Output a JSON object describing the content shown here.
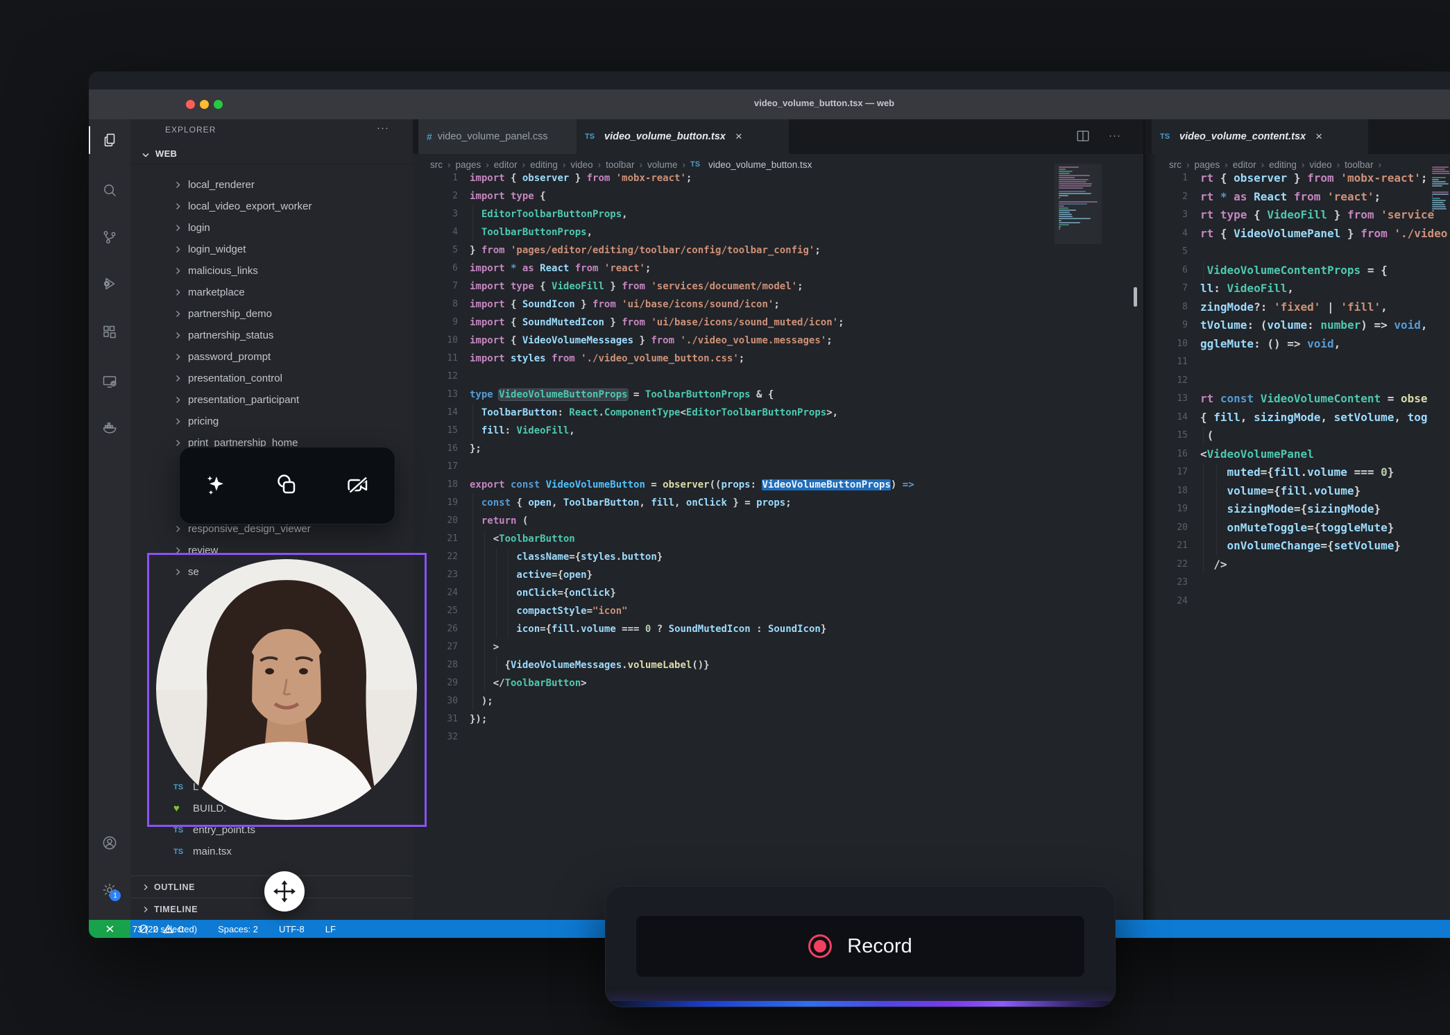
{
  "palette": {
    "kw": "#C586C0",
    "kc": "#569CD6",
    "var": "#9CDCFE",
    "typ": "#4EC9B0",
    "fn": "#DCDCAA",
    "str": "#CE9178",
    "num": "#B5CEA8",
    "pun": "#D4D4D4",
    "tag": "#4EC9B0",
    "cls": "#4FC1FF",
    "accent_purple": "#8B52F5",
    "record_red": "#F1415E",
    "status_blue": "#0E7AD3",
    "remote_green": "#18A24B",
    "traffic": [
      "#FF5F57",
      "#FEBC2E",
      "#28C840"
    ]
  },
  "window": {
    "title": "video_volume_button.tsx — web"
  },
  "activity_bar": {
    "items": [
      {
        "name": "explorer",
        "active": true
      },
      {
        "name": "search",
        "active": false
      },
      {
        "name": "source-control",
        "active": false
      },
      {
        "name": "run-and-debug",
        "active": false
      },
      {
        "name": "extensions",
        "active": false
      },
      {
        "name": "remote-window",
        "active": false
      },
      {
        "name": "docker",
        "active": false
      }
    ],
    "bottom": [
      {
        "name": "accounts"
      },
      {
        "name": "settings",
        "badge": "1"
      }
    ]
  },
  "explorer": {
    "title": "EXPLORER",
    "more": "···",
    "section": "WEB",
    "items": [
      {
        "kind": "folder",
        "label": "local_renderer"
      },
      {
        "kind": "folder",
        "label": "local_video_export_worker"
      },
      {
        "kind": "folder",
        "label": "login"
      },
      {
        "kind": "folder",
        "label": "login_widget"
      },
      {
        "kind": "folder",
        "label": "malicious_links"
      },
      {
        "kind": "folder",
        "label": "marketplace"
      },
      {
        "kind": "folder",
        "label": "partnership_demo"
      },
      {
        "kind": "folder",
        "label": "partnership_status"
      },
      {
        "kind": "folder",
        "label": "password_prompt"
      },
      {
        "kind": "folder",
        "label": "presentation_control"
      },
      {
        "kind": "folder",
        "label": "presentation_participant"
      },
      {
        "kind": "folder",
        "label": "pricing"
      },
      {
        "kind": "folder",
        "label": "print_partnership_home"
      },
      {
        "kind": "blank",
        "label": ""
      },
      {
        "kind": "blank",
        "label": ""
      },
      {
        "kind": "blank",
        "label": ""
      },
      {
        "kind": "folder",
        "label": "responsive_design_viewer"
      },
      {
        "kind": "folder",
        "label": "review"
      },
      {
        "kind": "folder",
        "label": "se"
      },
      {
        "kind": "blank",
        "label": ""
      },
      {
        "kind": "blank",
        "label": ""
      },
      {
        "kind": "blank",
        "label": ""
      },
      {
        "kind": "blank",
        "label": ""
      },
      {
        "kind": "blank",
        "label": ""
      },
      {
        "kind": "blank",
        "label": ""
      },
      {
        "kind": "blank",
        "label": ""
      },
      {
        "kind": "blank",
        "label": ""
      },
      {
        "kind": "blank",
        "label": ""
      },
      {
        "kind": "ts",
        "label": "L"
      },
      {
        "kind": "heart",
        "label": "BUILD."
      },
      {
        "kind": "ts",
        "label": "entry_point.ts"
      },
      {
        "kind": "ts",
        "label": "main.tsx"
      }
    ],
    "panels": [
      "OUTLINE",
      "TIMELINE"
    ]
  },
  "group1": {
    "tabs": [
      {
        "icon": "css",
        "label": "video_volume_panel.css",
        "active": false,
        "preview": false
      },
      {
        "icon": "ts",
        "label": "video_volume_button.tsx",
        "active": true,
        "preview": true,
        "close": "×"
      }
    ],
    "breadcrumbs": [
      {
        "label": "src"
      },
      {
        "label": "pages"
      },
      {
        "label": "editor"
      },
      {
        "label": "editing"
      },
      {
        "label": "video"
      },
      {
        "label": "toolbar"
      },
      {
        "label": "volume"
      },
      {
        "label": "video_volume_button.tsx",
        "icon": "ts"
      }
    ],
    "code": [
      [
        [
          "kw",
          "import"
        ],
        [
          "pun",
          " { "
        ],
        [
          "var",
          "observer"
        ],
        [
          "pun",
          " } "
        ],
        [
          "kw",
          "from"
        ],
        [
          "str",
          " 'mobx-react'"
        ],
        [
          "pun",
          ";"
        ]
      ],
      [
        [
          "kw",
          "import"
        ],
        [
          "kw",
          " type"
        ],
        [
          "pun",
          " {"
        ]
      ],
      [
        [
          "typ",
          "  EditorToolbarButtonProps"
        ],
        [
          "pun",
          ","
        ]
      ],
      [
        [
          "typ",
          "  ToolbarButtonProps"
        ],
        [
          "pun",
          ","
        ]
      ],
      [
        [
          "pun",
          "} "
        ],
        [
          "kw",
          "from"
        ],
        [
          "str",
          " 'pages/editor/editing/toolbar/config/toolbar_config'"
        ],
        [
          "pun",
          ";"
        ]
      ],
      [
        [
          "kw",
          "import"
        ],
        [
          "kc",
          " *"
        ],
        [
          "kw",
          " as"
        ],
        [
          "var",
          " React"
        ],
        [
          "kw",
          " from"
        ],
        [
          "str",
          " 'react'"
        ],
        [
          "pun",
          ";"
        ]
      ],
      [
        [
          "kw",
          "import"
        ],
        [
          "kw",
          " type"
        ],
        [
          "pun",
          " { "
        ],
        [
          "typ",
          "VideoFill"
        ],
        [
          "pun",
          " } "
        ],
        [
          "kw",
          "from"
        ],
        [
          "str",
          " 'services/document/model'"
        ],
        [
          "pun",
          ";"
        ]
      ],
      [
        [
          "kw",
          "import"
        ],
        [
          "pun",
          " { "
        ],
        [
          "var",
          "SoundIcon"
        ],
        [
          "pun",
          " } "
        ],
        [
          "kw",
          "from"
        ],
        [
          "str",
          " 'ui/base/icons/sound/icon'"
        ],
        [
          "pun",
          ";"
        ]
      ],
      [
        [
          "kw",
          "import"
        ],
        [
          "pun",
          " { "
        ],
        [
          "var",
          "SoundMutedIcon"
        ],
        [
          "pun",
          " } "
        ],
        [
          "kw",
          "from"
        ],
        [
          "str",
          " 'ui/base/icons/sound_muted/icon'"
        ],
        [
          "pun",
          ";"
        ]
      ],
      [
        [
          "kw",
          "import"
        ],
        [
          "pun",
          " { "
        ],
        [
          "var",
          "VideoVolumeMessages"
        ],
        [
          "pun",
          " } "
        ],
        [
          "kw",
          "from"
        ],
        [
          "str",
          " './video_volume.messages'"
        ],
        [
          "pun",
          ";"
        ]
      ],
      [
        [
          "kw",
          "import"
        ],
        [
          "var",
          " styles"
        ],
        [
          "kw",
          " from"
        ],
        [
          "str",
          " './video_volume_button.css'"
        ],
        [
          "pun",
          ";"
        ]
      ],
      [],
      [
        [
          "kc",
          "type "
        ],
        [
          "typ",
          "VideoVolumeButtonProps",
          "wd"
        ],
        [
          "pun",
          " = "
        ],
        [
          "typ",
          "ToolbarButtonProps"
        ],
        [
          "pun",
          " & {"
        ]
      ],
      [
        [
          "var",
          "  ToolbarButton"
        ],
        [
          "pun",
          ": "
        ],
        [
          "typ",
          "React"
        ],
        [
          "pun",
          "."
        ],
        [
          "typ",
          "ComponentType"
        ],
        [
          "pun",
          "<"
        ],
        [
          "typ",
          "EditorToolbarButtonProps"
        ],
        [
          "pun",
          ">,"
        ]
      ],
      [
        [
          "var",
          "  fill"
        ],
        [
          "pun",
          ": "
        ],
        [
          "typ",
          "VideoFill"
        ],
        [
          "pun",
          ","
        ]
      ],
      [
        [
          "pun",
          "};"
        ]
      ],
      [],
      [
        [
          "kw",
          "export"
        ],
        [
          "kc",
          " const"
        ],
        [
          "cls",
          " VideoVolumeButton"
        ],
        [
          "pun",
          " = "
        ],
        [
          "fn",
          "observer"
        ],
        [
          "pun",
          "(("
        ],
        [
          "var",
          "props"
        ],
        [
          "pun",
          ": "
        ],
        [
          "typ",
          "VideoVolumeButtonProps",
          "sel"
        ],
        [
          "pun",
          ")"
        ],
        [
          "kc",
          " =>"
        ]
      ],
      [
        [
          "kc",
          "  const"
        ],
        [
          "pun",
          " { "
        ],
        [
          "var",
          "open"
        ],
        [
          "pun",
          ", "
        ],
        [
          "var",
          "ToolbarButton"
        ],
        [
          "pun",
          ", "
        ],
        [
          "var",
          "fill"
        ],
        [
          "pun",
          ", "
        ],
        [
          "var",
          "onClick"
        ],
        [
          "pun",
          " } = "
        ],
        [
          "var",
          "props"
        ],
        [
          "pun",
          ";"
        ]
      ],
      [
        [
          "kw",
          "  return"
        ],
        [
          "pun",
          " ("
        ]
      ],
      [
        [
          "pun",
          "    <"
        ],
        [
          "tag",
          "ToolbarButton"
        ]
      ],
      [
        [
          "var",
          "        className"
        ],
        [
          "pun",
          "={"
        ],
        [
          "var",
          "styles"
        ],
        [
          "pun",
          "."
        ],
        [
          "var",
          "button"
        ],
        [
          "pun",
          "}"
        ]
      ],
      [
        [
          "var",
          "        active"
        ],
        [
          "pun",
          "={"
        ],
        [
          "var",
          "open"
        ],
        [
          "pun",
          "}"
        ]
      ],
      [
        [
          "var",
          "        onClick"
        ],
        [
          "pun",
          "={"
        ],
        [
          "var",
          "onClick"
        ],
        [
          "pun",
          "}"
        ]
      ],
      [
        [
          "var",
          "        compactStyle"
        ],
        [
          "pun",
          "="
        ],
        [
          "str",
          "\"icon\""
        ]
      ],
      [
        [
          "var",
          "        icon"
        ],
        [
          "pun",
          "={"
        ],
        [
          "var",
          "fill"
        ],
        [
          "pun",
          "."
        ],
        [
          "var",
          "volume"
        ],
        [
          "pun",
          " === "
        ],
        [
          "num",
          "0"
        ],
        [
          "pun",
          " ? "
        ],
        [
          "var",
          "SoundMutedIcon"
        ],
        [
          "pun",
          " : "
        ],
        [
          "var",
          "SoundIcon"
        ],
        [
          "pun",
          "}"
        ]
      ],
      [
        [
          "pun",
          "    >"
        ]
      ],
      [
        [
          "pun",
          "      {"
        ],
        [
          "var",
          "VideoVolumeMessages"
        ],
        [
          "pun",
          "."
        ],
        [
          "fn",
          "volumeLabel"
        ],
        [
          "pun",
          "()}"
        ]
      ],
      [
        [
          "pun",
          "    </"
        ],
        [
          "tag",
          "ToolbarButton"
        ],
        [
          "pun",
          ">"
        ]
      ],
      [
        [
          "pun",
          "  );"
        ]
      ],
      [
        [
          "pun",
          "});"
        ]
      ],
      []
    ]
  },
  "group2": {
    "tabs": [
      {
        "icon": "ts",
        "label": "video_volume_content.tsx",
        "active": true,
        "preview": true,
        "close": "×"
      }
    ],
    "breadcrumbs": [
      {
        "label": "src"
      },
      {
        "label": "pages"
      },
      {
        "label": "editor"
      },
      {
        "label": "editing"
      },
      {
        "label": "video"
      },
      {
        "label": "toolbar"
      }
    ],
    "trailing_sep": true,
    "code": [
      [
        [
          "kw",
          "rt"
        ],
        [
          "pun",
          " { "
        ],
        [
          "var",
          "observer"
        ],
        [
          "pun",
          " } "
        ],
        [
          "kw",
          "from"
        ],
        [
          "str",
          " 'mobx-react'"
        ],
        [
          "pun",
          ";"
        ]
      ],
      [
        [
          "kw",
          "rt"
        ],
        [
          "kc",
          " *"
        ],
        [
          "kw",
          " as"
        ],
        [
          "var",
          " React"
        ],
        [
          "kw",
          " from"
        ],
        [
          "str",
          " 'react'"
        ],
        [
          "pun",
          ";"
        ]
      ],
      [
        [
          "kw",
          "rt"
        ],
        [
          "kw",
          " type"
        ],
        [
          "pun",
          " { "
        ],
        [
          "typ",
          "VideoFill"
        ],
        [
          "pun",
          " } "
        ],
        [
          "kw",
          "from"
        ],
        [
          "str",
          " 'service"
        ]
      ],
      [
        [
          "kw",
          "rt"
        ],
        [
          "pun",
          " { "
        ],
        [
          "var",
          "VideoVolumePanel"
        ],
        [
          "pun",
          " } "
        ],
        [
          "kw",
          "from"
        ],
        [
          "str",
          " './video"
        ]
      ],
      [],
      [
        [
          "typ",
          " VideoVolumeContentProps"
        ],
        [
          "pun",
          " = {"
        ]
      ],
      [
        [
          "var",
          "ll"
        ],
        [
          "pun",
          ": "
        ],
        [
          "typ",
          "VideoFill"
        ],
        [
          "pun",
          ","
        ]
      ],
      [
        [
          "var",
          "zingMode"
        ],
        [
          "pun",
          "?: "
        ],
        [
          "str",
          "'fixed'"
        ],
        [
          "pun",
          " | "
        ],
        [
          "str",
          "'fill'"
        ],
        [
          "pun",
          ","
        ]
      ],
      [
        [
          "var",
          "tVolume"
        ],
        [
          "pun",
          ": ("
        ],
        [
          "var",
          "volume"
        ],
        [
          "pun",
          ": "
        ],
        [
          "typ",
          "number"
        ],
        [
          "pun",
          ") => "
        ],
        [
          "kc",
          "void"
        ],
        [
          "pun",
          ","
        ]
      ],
      [
        [
          "var",
          "ggleMute"
        ],
        [
          "pun",
          ": () => "
        ],
        [
          "kc",
          "void"
        ],
        [
          "pun",
          ","
        ]
      ],
      [],
      [],
      [
        [
          "kw",
          "rt"
        ],
        [
          "kc",
          " const"
        ],
        [
          "typ",
          " VideoVolumeContent"
        ],
        [
          "pun",
          " = "
        ],
        [
          "fn",
          "obse"
        ]
      ],
      [
        [
          "pun",
          "{ "
        ],
        [
          "var",
          "fill"
        ],
        [
          "pun",
          ", "
        ],
        [
          "var",
          "sizingMode"
        ],
        [
          "pun",
          ", "
        ],
        [
          "var",
          "setVolume"
        ],
        [
          "pun",
          ", "
        ],
        [
          "var",
          "tog"
        ]
      ],
      [
        [
          "pun",
          " ("
        ]
      ],
      [
        [
          "pun",
          "<"
        ],
        [
          "tag",
          "VideoVolumePanel"
        ]
      ],
      [
        [
          "var",
          "    muted"
        ],
        [
          "pun",
          "={"
        ],
        [
          "var",
          "fill"
        ],
        [
          "pun",
          "."
        ],
        [
          "var",
          "volume"
        ],
        [
          "pun",
          " === "
        ],
        [
          "num",
          "0"
        ],
        [
          "pun",
          "}"
        ]
      ],
      [
        [
          "var",
          "    volume"
        ],
        [
          "pun",
          "={"
        ],
        [
          "var",
          "fill"
        ],
        [
          "pun",
          "."
        ],
        [
          "var",
          "volume"
        ],
        [
          "pun",
          "}"
        ]
      ],
      [
        [
          "var",
          "    sizingMode"
        ],
        [
          "pun",
          "={"
        ],
        [
          "var",
          "sizingMode"
        ],
        [
          "pun",
          "}"
        ]
      ],
      [
        [
          "var",
          "    onMuteToggle"
        ],
        [
          "pun",
          "={"
        ],
        [
          "var",
          "toggleMute"
        ],
        [
          "pun",
          "}"
        ]
      ],
      [
        [
          "var",
          "    onVolumeChange"
        ],
        [
          "pun",
          "={"
        ],
        [
          "var",
          "setVolume"
        ],
        [
          "pun",
          "}"
        ]
      ],
      [
        [
          "pun",
          "  />"
        ]
      ],
      [],
      []
    ]
  },
  "status_bar": {
    "problems": {
      "errors": "0",
      "warnings": "0"
    },
    "right": [
      "Ln 18, Col 73 (22 selected)",
      "Spaces: 2",
      "UTF-8",
      "LF"
    ]
  },
  "overlays": {
    "toolbar": {
      "items": [
        "ai-effects",
        "shapes",
        "camera-off"
      ]
    },
    "record": {
      "label": "Record"
    }
  }
}
